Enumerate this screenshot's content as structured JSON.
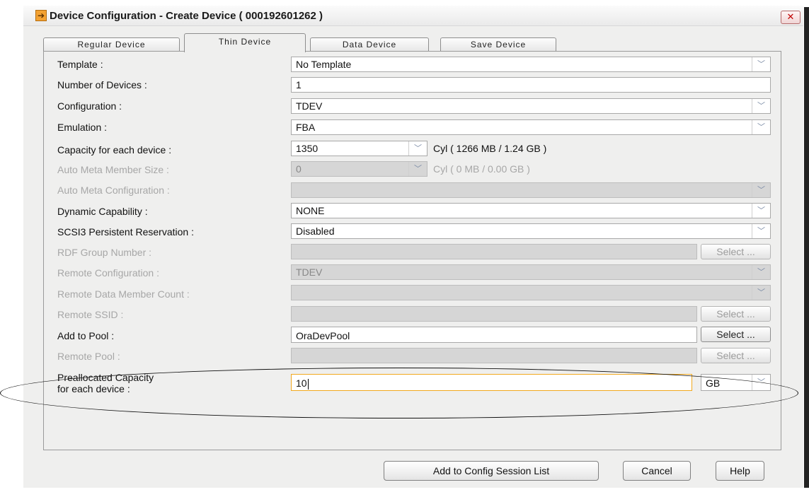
{
  "window": {
    "title": "Device Configuration - Create Device ( 000192601262 )",
    "close_glyph": "✕"
  },
  "tabs": [
    {
      "label": "Regular Device",
      "active": false
    },
    {
      "label": "Thin Device",
      "active": true
    },
    {
      "label": "Data Device",
      "active": false
    },
    {
      "label": "Save Device",
      "active": false
    }
  ],
  "form": {
    "template": {
      "label": "Template :",
      "value": "No Template"
    },
    "num_devices": {
      "label": "Number of Devices :",
      "value": "1"
    },
    "configuration": {
      "label": "Configuration :",
      "value": "TDEV"
    },
    "emulation": {
      "label": "Emulation :",
      "value": "FBA"
    },
    "capacity": {
      "label": "Capacity for each device :",
      "value": "1350",
      "unit_text": "Cyl ( 1266 MB / 1.24 GB )"
    },
    "auto_meta_size": {
      "label": "Auto Meta Member Size :",
      "value": "0",
      "unit_text": "Cyl ( 0 MB / 0.00 GB )"
    },
    "auto_meta_config": {
      "label": "Auto Meta Configuration :",
      "value": ""
    },
    "dynamic_capability": {
      "label": "Dynamic Capability :",
      "value": "NONE"
    },
    "scsi3": {
      "label": "SCSI3 Persistent Reservation :",
      "value": "Disabled"
    },
    "rdf_group": {
      "label": "RDF Group Number :",
      "value": "",
      "button": "Select ..."
    },
    "remote_config": {
      "label": "Remote Configuration :",
      "value": "TDEV"
    },
    "remote_data_member_count": {
      "label": "Remote Data Member Count :",
      "value": ""
    },
    "remote_ssid": {
      "label": "Remote SSID :",
      "value": "",
      "button": "Select ..."
    },
    "add_to_pool": {
      "label": "Add to Pool :",
      "value": "OraDevPool",
      "button": "Select ..."
    },
    "remote_pool": {
      "label": "Remote Pool :",
      "value": "",
      "button": "Select ..."
    },
    "preallocated": {
      "label_line1": "Preallocated Capacity",
      "label_line2": "for each device :",
      "value": "10",
      "unit": "GB"
    }
  },
  "buttons": {
    "add_to_session": "Add to Config Session List",
    "cancel": "Cancel",
    "help": "Help"
  },
  "icons": {
    "app": "arrow-right-icon",
    "close": "close-icon",
    "dropdown": "chevron-down-icon"
  },
  "colors": {
    "focus_border": "#f1a81e",
    "close": "#c00000"
  }
}
